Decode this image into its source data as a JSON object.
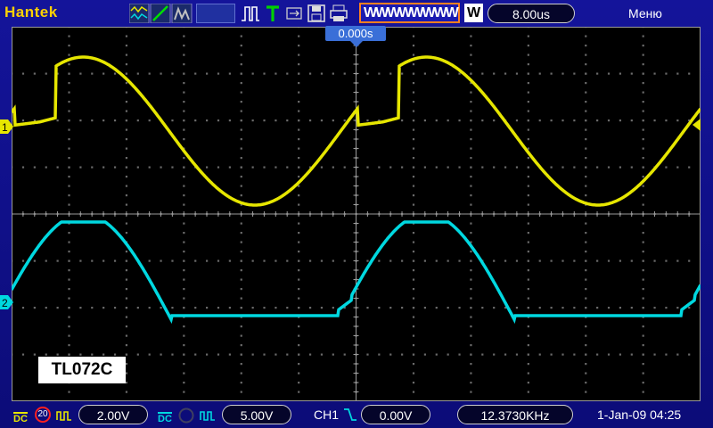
{
  "header": {
    "brand": "Hantek",
    "waveform_mode": "WWWWWWWW",
    "timebase_mode": "W",
    "timebase": "8.00us",
    "menu": "Меню",
    "trigger_time": "0.000s"
  },
  "icons": {
    "acquire": "acquire-mode-icon",
    "run": "run-stop-icon",
    "trigger": "trigger-t-icon",
    "usb": "usb-icon",
    "save": "save-icon",
    "print": "printer-icon"
  },
  "overlay": {
    "label": "TL072C"
  },
  "channels": [
    {
      "marker": "1",
      "color": "#e6e600",
      "coupling": "DC",
      "scale": "2.00V",
      "bw": "20"
    },
    {
      "marker": "2",
      "color": "#00d8e0",
      "coupling": "DC",
      "scale": "5.00V"
    }
  ],
  "footer": {
    "trigger_source": "CH1",
    "trigger_level": "0.00V",
    "frequency": "12.3730KHz",
    "datetime": "1-Jan-09 04:25"
  },
  "colors": {
    "ch1": "#e6e600",
    "ch2": "#00d8e0",
    "brand": "#ffd200",
    "background": "#000000",
    "grid": "#808080"
  }
}
